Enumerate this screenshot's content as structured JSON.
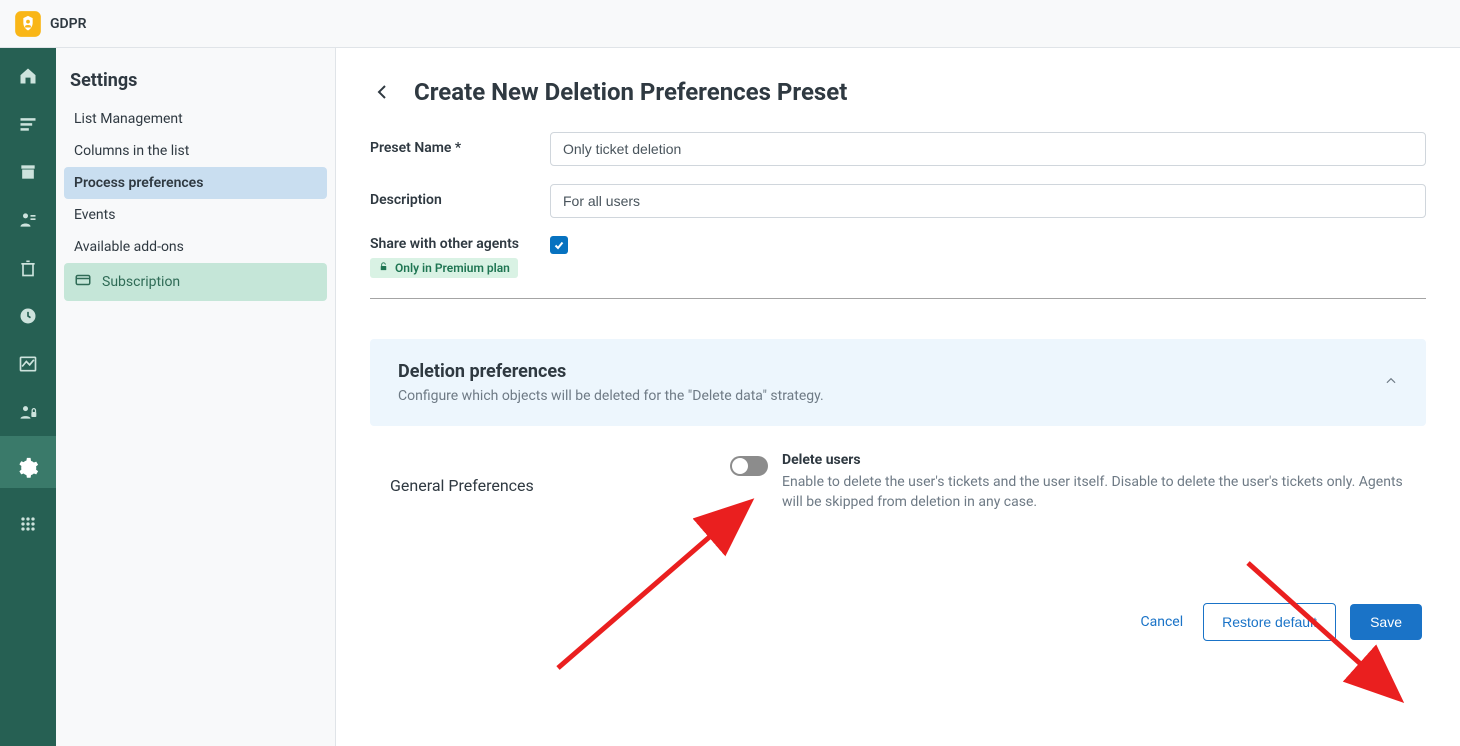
{
  "app": {
    "title": "GDPR"
  },
  "sidebar": {
    "heading": "Settings",
    "items": [
      {
        "label": "List Management"
      },
      {
        "label": "Columns in the list"
      },
      {
        "label": "Process preferences"
      },
      {
        "label": "Events"
      },
      {
        "label": "Available add-ons"
      },
      {
        "label": "Subscription"
      }
    ]
  },
  "page": {
    "title": "Create New Deletion Preferences Preset",
    "form": {
      "preset_name_label": "Preset Name *",
      "preset_name_value": "Only ticket deletion",
      "description_label": "Description",
      "description_value": "For all users",
      "share_label": "Share with other agents",
      "premium_badge": "Only in Premium plan"
    },
    "panel": {
      "title": "Deletion preferences",
      "desc": "Configure which objects will be deleted for the \"Delete data\" strategy."
    },
    "general": {
      "section_label": "General Preferences",
      "toggle_title": "Delete users",
      "toggle_desc": "Enable to delete the user's tickets and the user itself. Disable to delete the user's tickets only. Agents will be skipped from deletion in any case."
    },
    "actions": {
      "cancel": "Cancel",
      "restore": "Restore default",
      "save": "Save"
    }
  }
}
